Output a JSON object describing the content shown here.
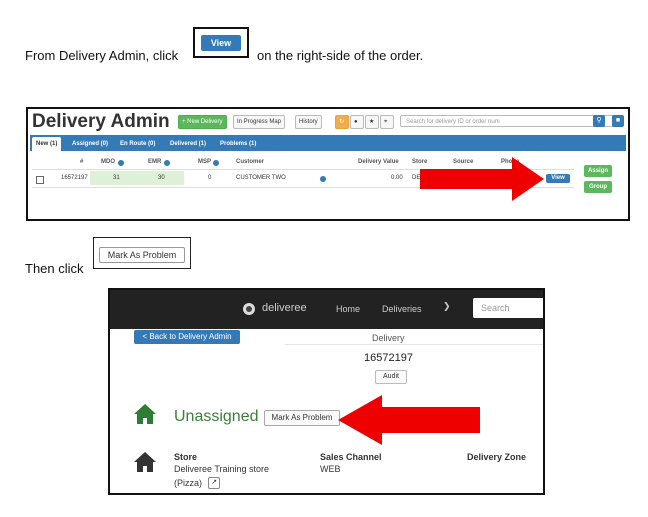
{
  "instructions": {
    "step1_prefix": "From Delivery Admin, click",
    "step1_suffix": "on the right-side of the order.",
    "step2_prefix": "Then click",
    "view_button_label": "View",
    "mark_problem_label": "Mark As Problem"
  },
  "delivery_admin": {
    "title": "Delivery Admin",
    "toolbar": {
      "new_delivery": "+ New Delivery",
      "in_progress_map": "In Progress Map",
      "history": "History"
    },
    "search_placeholder": "Search for delivery ID or order num",
    "tabs": [
      "New (1)",
      "Assigned (0)",
      "En Route (0)",
      "Delivered (1)",
      "Problems (1)"
    ],
    "columns": [
      "#",
      "MDO",
      "EMR",
      "MSP",
      "Customer",
      "Delivery Value",
      "Store",
      "Source",
      "Phone"
    ],
    "row": {
      "id": "16572197",
      "mdo": "31",
      "emr": "30",
      "msp": "0",
      "customer": "CUSTOMER TWO",
      "value": "0.00",
      "store_partial": "DE",
      "view": "View"
    },
    "side_buttons": {
      "assign": "Assign",
      "group": "Group"
    }
  },
  "detail": {
    "brand": "deliveree",
    "nav": [
      "Home",
      "Deliveries"
    ],
    "search_placeholder": "Search",
    "back_button": "< Back to Delivery Admin",
    "section_label": "Delivery",
    "delivery_number": "16572197",
    "audit_button": "Audit",
    "status": "Unassigned",
    "mark_problem_button": "Mark As Problem",
    "store_label": "Store",
    "store_value_line1": "Deliveree Training store",
    "store_value_line2": "(Pizza)",
    "sales_channel_label": "Sales Channel",
    "sales_channel_value": "WEB",
    "delivery_zone_label": "Delivery Zone"
  },
  "colors": {
    "arrow": "#ee0000",
    "primary": "#337ab7",
    "success": "#5cb85c",
    "home_icon": "#2e7d32"
  }
}
